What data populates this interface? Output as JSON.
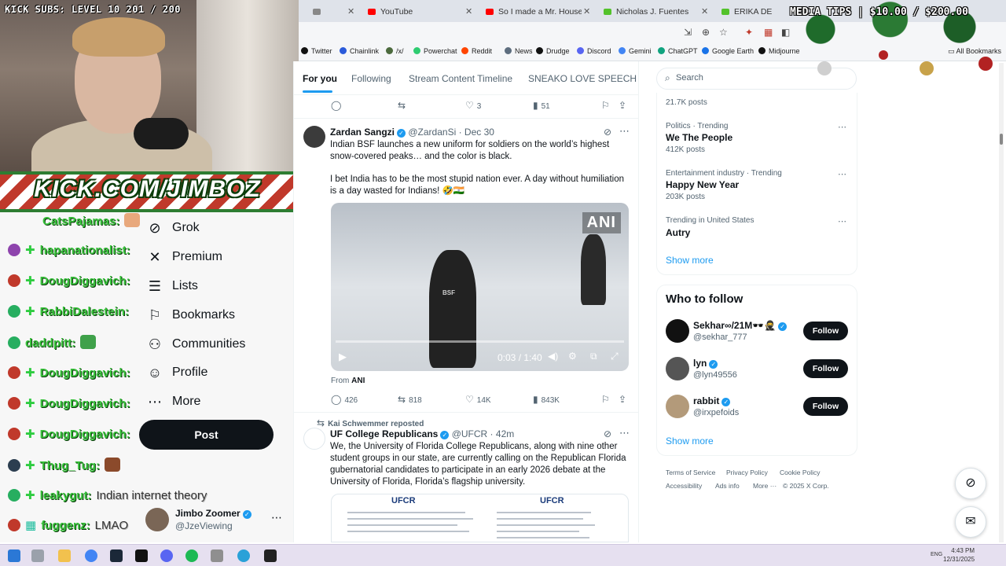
{
  "browser": {
    "tabs": [
      {
        "label": "",
        "color": "#888888"
      },
      {
        "label": "YouTube",
        "color": "#ff0000"
      },
      {
        "label": "So I made a Mr. House comp",
        "color": "#ff0000"
      },
      {
        "label": "Nicholas J. Fuentes",
        "color": "#53c22b"
      },
      {
        "label": "ERIKA DE",
        "color": "#53c22b"
      }
    ],
    "bookmarks": [
      {
        "label": "Twitter",
        "color": "#111111"
      },
      {
        "label": "Chainlink",
        "color": "#2a5ada"
      },
      {
        "label": "/x/",
        "color": "#4c6a3d"
      },
      {
        "label": "Powerchat",
        "color": "#2ecc71"
      },
      {
        "label": "Reddit",
        "color": "#ff4500"
      },
      {
        "label": "News",
        "color": "#5d6d7e"
      },
      {
        "label": "Drudge",
        "color": "#111111"
      },
      {
        "label": "Discord",
        "color": "#5865f2"
      },
      {
        "label": "Gemini",
        "color": "#4285f4"
      },
      {
        "label": "ChatGPT",
        "color": "#10a37f"
      },
      {
        "label": "Google Earth",
        "color": "#1a73e8"
      },
      {
        "label": "Midjourne",
        "color": "#111111"
      }
    ],
    "all_bookmarks": "All Bookmarks"
  },
  "stream": {
    "kick_subs": "KICK SUBS: LEVEL 10 201 / 200",
    "banner": "KICK.COM/JIMBOZ",
    "media_tips": "MEDIA TIPS | $10.00 / $200.00",
    "chat": [
      {
        "user": "CatsPajamas:",
        "msg": "",
        "badge": "#e74c3c"
      },
      {
        "user": "hapanationalist:",
        "msg": "",
        "badge": "#8e44ad"
      },
      {
        "user": "DougDiggavich:",
        "msg": "",
        "badge": "#c0392b"
      },
      {
        "user": "RabbiDalestein:",
        "msg": "",
        "badge": "#27ae60"
      },
      {
        "user": "daddpitt:",
        "msg": "",
        "badge": "#27ae60"
      },
      {
        "user": "DougDiggavich:",
        "msg": "",
        "badge": "#c0392b"
      },
      {
        "user": "DougDiggavich:",
        "msg": "",
        "badge": "#c0392b"
      },
      {
        "user": "DougDiggavich:",
        "msg": "",
        "badge": "#c0392b"
      },
      {
        "user": "Thug_Tug:",
        "msg": "",
        "badge": "#2c3e50"
      },
      {
        "user": "leakygut:",
        "msg": "Indian internet theory",
        "badge": "#27ae60"
      },
      {
        "user": "fuggenz:",
        "msg": "LMAO",
        "badge": "#c0392b"
      }
    ]
  },
  "x_nav": {
    "items": [
      {
        "label": "Grok",
        "icon": "grok-icon",
        "glyph": "⊘"
      },
      {
        "label": "Premium",
        "icon": "x-premium-icon",
        "glyph": "✕"
      },
      {
        "label": "Lists",
        "icon": "lists-icon",
        "glyph": "☰"
      },
      {
        "label": "Bookmarks",
        "icon": "bookmark-icon",
        "glyph": "⚐"
      },
      {
        "label": "Communities",
        "icon": "communities-icon",
        "glyph": "⚇"
      },
      {
        "label": "Profile",
        "icon": "profile-icon",
        "glyph": "☺"
      },
      {
        "label": "More",
        "icon": "more-circle-icon",
        "glyph": "⋯"
      }
    ],
    "post_label": "Post",
    "account": {
      "name": "Jimbo Zoomer",
      "handle": "@JzeViewing"
    }
  },
  "feed": {
    "tabs": [
      "For you",
      "Following",
      "Stream Content Timeline",
      "SNEAKO LOVE SPEECH"
    ],
    "prev_actions": {
      "replies": "",
      "reposts": "",
      "likes": "3",
      "views": "51"
    },
    "tweet1": {
      "name": "Zardan Sangzi",
      "handle": "@ZardanSi",
      "date": "Dec 30",
      "text1": "Indian BSF launches a new uniform for soldiers on the world’s highest snow-covered peaks… and the color is black.",
      "text2": "I bet India has to be the most stupid nation ever. A day without humiliation is a day wasted for Indians! 🤣🇮🇳",
      "video_watermark": "ANI",
      "video_bsf": "BSF",
      "video_time": "0:03 / 1:40",
      "from_label": "From",
      "from_source": "ANI",
      "actions": {
        "replies": "426",
        "reposts": "818",
        "likes": "14K",
        "views": "843K"
      }
    },
    "tweet2": {
      "reposted_by": "Kai Schwemmer reposted",
      "name": "UF College Republicans",
      "handle": "@UFCR",
      "date": "42m",
      "text": "We, the University of Florida College Republicans, along with nine other student groups in our state, are currently calling on the Republican Florida gubernatorial candidates to participate in an early 2026 debate at the University of Florida, Florida’s flagship university.",
      "img_logo": "UFCR"
    }
  },
  "sidebar": {
    "search_placeholder": "Search",
    "trends": [
      {
        "context": "",
        "name": "",
        "posts": "21.7K posts"
      },
      {
        "context": "Politics · Trending",
        "name": "We The People",
        "posts": "412K posts"
      },
      {
        "context": "Entertainment industry · Trending",
        "name": "Happy New Year",
        "posts": "203K posts"
      },
      {
        "context": "Trending in United States",
        "name": "Autry",
        "posts": ""
      }
    ],
    "show_more": "Show more",
    "who_to_follow_title": "Who to follow",
    "who_to_follow": [
      {
        "name": "Sekhar∞/21M🕶️🥷",
        "handle": "@sekhar_777",
        "avatar": "#111111"
      },
      {
        "name": "lyn",
        "handle": "@lyn49556",
        "avatar": "#555555"
      },
      {
        "name": "rabbit",
        "handle": "@irxpefoids",
        "avatar": "#b39a7a"
      }
    ],
    "follow_label": "Follow",
    "footer": [
      "Terms of Service",
      "Privacy Policy",
      "Cookie Policy",
      "Accessibility",
      "Ads info",
      "More ···",
      "© 2025 X Corp."
    ]
  },
  "taskbar": {
    "lang": "ENG",
    "time": "4:43 PM",
    "date": "12/31/2025"
  },
  "colors": {
    "x_blue": "#1d9bf0",
    "x_black": "#0f1419",
    "chat_green": "#37c13a"
  }
}
